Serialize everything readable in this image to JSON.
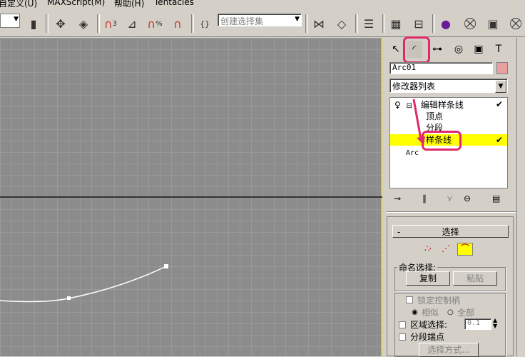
{
  "menu": {
    "items": [
      "自定义(U)",
      "MAXScript(M)",
      "帮助(H)",
      "Tentacles"
    ]
  },
  "toolbar": {
    "selection_set_placeholder": "创建选择集",
    "snap_angle_label": "3",
    "snap_percent_label": "%"
  },
  "panel": {
    "object_name": "Arc01",
    "object_color": "#e8a0a0",
    "modifier_list_label": "修改器列表",
    "stack": {
      "modifier": "编辑样条线",
      "sub_vertex": "顶点",
      "sub_segment": "分段",
      "sub_spline": "样条线",
      "base_object": "Arc"
    },
    "rollout_selection": {
      "header_sign": "-",
      "title": "选择",
      "named_selection_label": "命名选择:",
      "copy_button": "复制",
      "paste_button": "粘贴",
      "lock_handles_label": "锁定控制柄",
      "similar_label": "相似",
      "all_label": "全部",
      "area_selection_label": "区域选择:",
      "area_value": "0.1",
      "segment_end_label": "分段端点",
      "select_by_button": "选择方式..."
    }
  },
  "colors": {
    "highlight": "#e0286c",
    "selected_row": "#ffff00",
    "viewport_bg": "#8c8c8c"
  }
}
